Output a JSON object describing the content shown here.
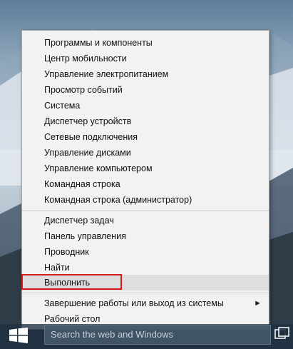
{
  "context_menu": {
    "items": [
      {
        "label": "Программы и компоненты"
      },
      {
        "label": "Центр мобильности"
      },
      {
        "label": "Управление электропитанием"
      },
      {
        "label": "Просмотр событий"
      },
      {
        "label": "Система"
      },
      {
        "label": "Диспетчер устройств"
      },
      {
        "label": "Сетевые подключения"
      },
      {
        "label": "Управление дисками"
      },
      {
        "label": "Управление компьютером"
      },
      {
        "label": "Командная строка"
      },
      {
        "label": "Командная строка (администратор)"
      },
      {
        "label": "Диспетчер задач"
      },
      {
        "label": "Панель управления"
      },
      {
        "label": "Проводник"
      },
      {
        "label": "Найти"
      },
      {
        "label": "Выполнить",
        "highlighted": true
      },
      {
        "label": "Завершение работы или выход из системы",
        "has_submenu": true
      },
      {
        "label": "Рабочий стол"
      }
    ],
    "highlight_color": "#d41c1c"
  },
  "taskbar": {
    "search_placeholder": "Search the web and Windows",
    "start_icon": "windows-logo-icon",
    "task_view_icon": "task-view-icon"
  }
}
